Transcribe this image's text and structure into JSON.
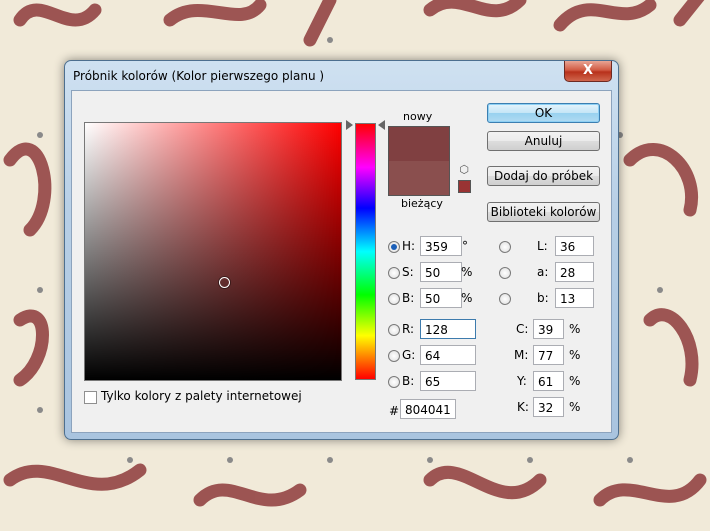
{
  "dialog": {
    "title": "Próbnik kolorów (Kolor pierwszego planu )",
    "close_label": "X"
  },
  "preview": {
    "new_label": "nowy",
    "current_label": "bieżący",
    "new_color": "#804041",
    "current_color": "#8a4f4e"
  },
  "buttons": {
    "ok": "OK",
    "cancel": "Anuluj",
    "add_swatch": "Dodaj do próbek",
    "libraries": "Biblioteki kolorów"
  },
  "hsb": {
    "h_label": "H:",
    "h_value": "359",
    "h_unit": "°",
    "s_label": "S:",
    "s_value": "50",
    "s_unit": "%",
    "b_label": "B:",
    "b_value": "50",
    "b_unit": "%"
  },
  "rgb": {
    "r_label": "R:",
    "r_value": "128",
    "g_label": "G:",
    "g_value": "64",
    "b_label": "B:",
    "b_value": "65"
  },
  "lab": {
    "l_label": "L:",
    "l_value": "36",
    "a_label": "a:",
    "a_value": "28",
    "b_label": "b:",
    "b_value": "13"
  },
  "cmyk": {
    "c_label": "C:",
    "c_value": "39",
    "m_label": "M:",
    "m_value": "77",
    "y_label": "Y:",
    "y_value": "61",
    "k_label": "K:",
    "k_value": "32",
    "unit": "%"
  },
  "hex": {
    "label": "#",
    "value": "804041"
  },
  "web_only_label": "Tylko kolory z palety internetowej",
  "colors": {
    "background_ink": "#8b3a3a",
    "accent": "#3c7fb1"
  }
}
